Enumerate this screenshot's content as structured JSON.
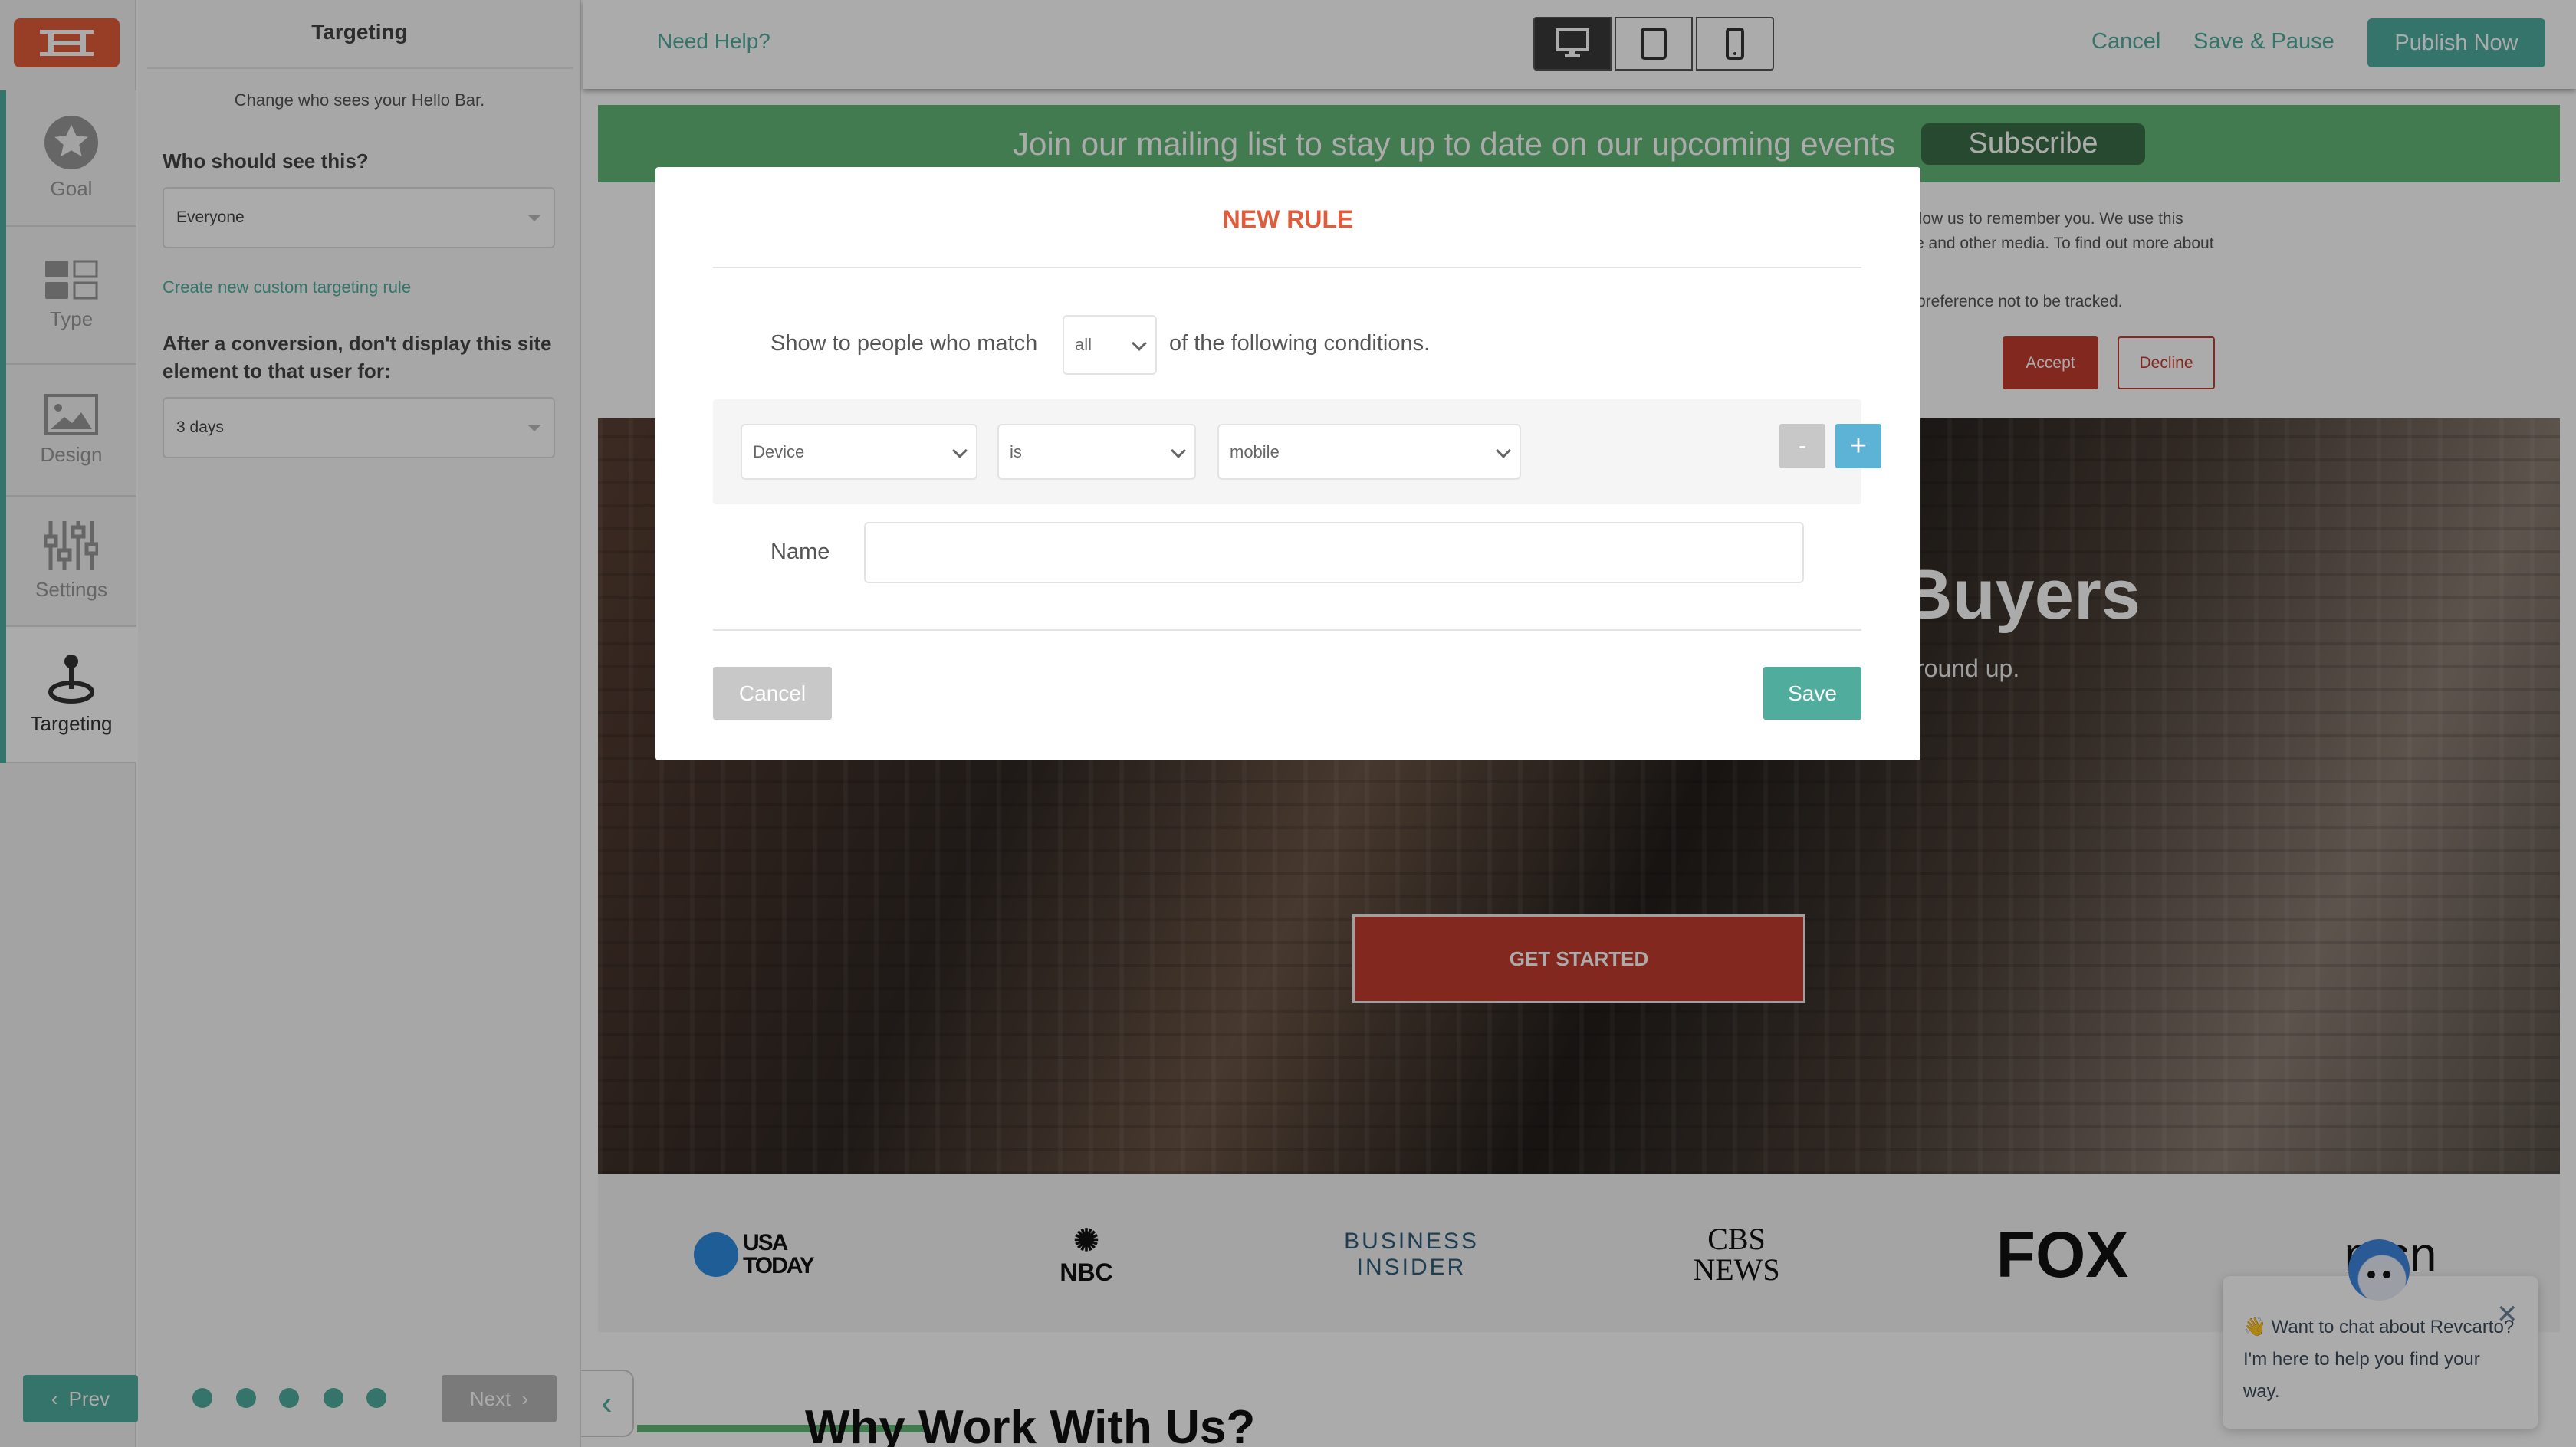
{
  "colors": {
    "accent": "#50ad9e",
    "brand": "#e35d3b",
    "hello_bar": "#63b878",
    "modal_title": "#e05c3a",
    "add_button": "#5db3d6"
  },
  "rail": {
    "logo_icon": "hellobar-logo",
    "items": [
      {
        "label": "Goal",
        "icon": "star-icon"
      },
      {
        "label": "Type",
        "icon": "layout-icon"
      },
      {
        "label": "Design",
        "icon": "image-icon"
      },
      {
        "label": "Settings",
        "icon": "sliders-icon"
      },
      {
        "label": "Targeting",
        "icon": "joystick-icon",
        "active": true
      }
    ]
  },
  "panel": {
    "title": "Targeting",
    "subtitle": "Change who sees your Hello Bar.",
    "who_label": "Who should see this?",
    "who_value": "Everyone",
    "create_link": "Create new custom targeting rule",
    "after_label": "After a conversion, don't display this site element to that user for:",
    "after_value": "3 days",
    "prev": "Prev",
    "next": "Next",
    "steps": 5
  },
  "toolbar": {
    "help": "Need Help?",
    "devices": [
      "desktop",
      "tablet",
      "mobile"
    ],
    "active_device": "desktop",
    "cancel": "Cancel",
    "save_pause": "Save & Pause",
    "publish": "Publish Now"
  },
  "preview": {
    "hello_bar_text": "Join our mailing list to stay up to date on our upcoming events",
    "subscribe": "Subscribe",
    "cookie_line1": "llow us to remember you. We use this",
    "cookie_line2": "e and other media. To find out more about",
    "cookie_line3": "preference not to be tracked.",
    "accept": "Accept",
    "decline": "Decline",
    "hero_heading": "Buyers",
    "hero_sub": "round up.",
    "cta": "GET STARTED",
    "logos": [
      "USA TODAY",
      "NBC",
      "BUSINESS INSIDER",
      "CBS NEWS",
      "FOX",
      "msn"
    ],
    "section_heading": "Why Work With Us?"
  },
  "chat": {
    "message": "👋 Want to chat about Revcarto? I'm here to help you find your way."
  },
  "modal": {
    "title": "NEW RULE",
    "match_prefix": "Show to people who match",
    "match_value": "all",
    "match_suffix": "of the following conditions.",
    "condition": {
      "field": "Device",
      "operator": "is",
      "value": "mobile"
    },
    "remove": "-",
    "add": "+",
    "name_label": "Name",
    "name_value": "",
    "cancel": "Cancel",
    "save": "Save"
  }
}
